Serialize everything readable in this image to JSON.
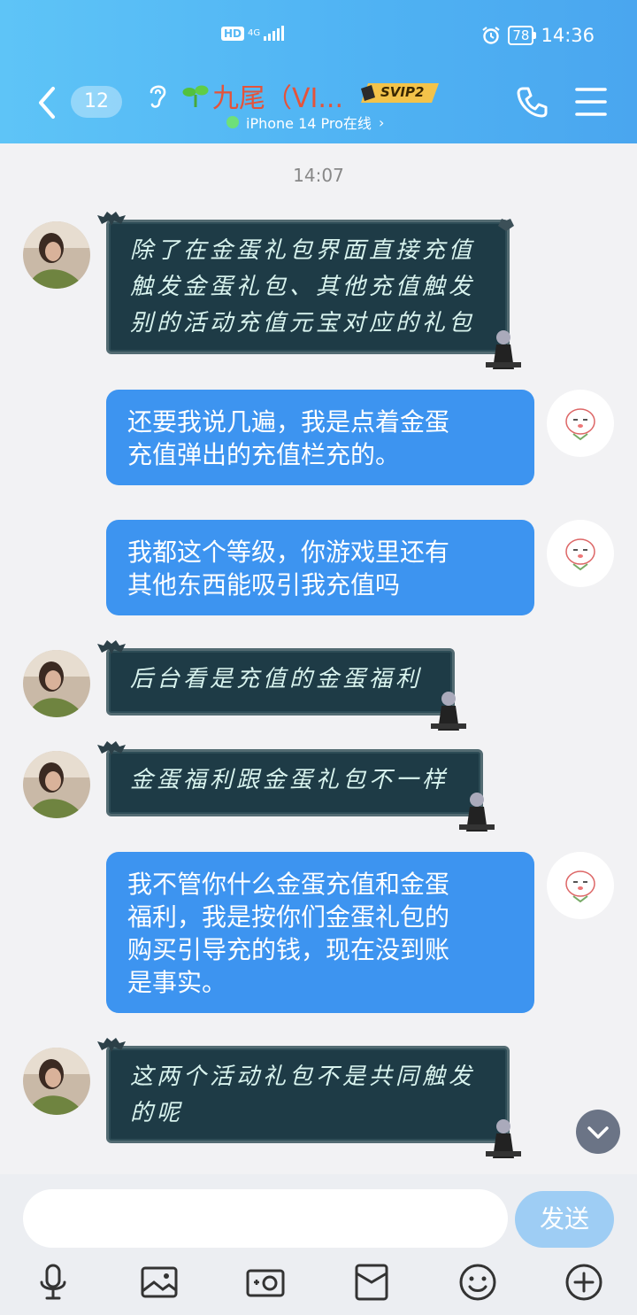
{
  "status_bar": {
    "hd": "HD",
    "network": "4G",
    "battery": "78",
    "time": "14:36"
  },
  "header": {
    "unread_count": "12",
    "contact_name": "九尾（VI...",
    "svip_badge": "SVIP2",
    "online_status": "iPhone 14 Pro在线",
    "online_chevron": "›"
  },
  "chat": {
    "timestamp": "14:07",
    "messages": [
      {
        "side": "in",
        "lines": [
          "除了在金蛋礼包界面直接充值",
          "触发金蛋礼包、其他充值触发",
          "别的活动充值元宝对应的礼包"
        ]
      },
      {
        "side": "out",
        "lines": [
          "还要我说几遍，我是点着金蛋",
          "充值弹出的充值栏充的。"
        ]
      },
      {
        "side": "out",
        "lines": [
          "我都这个等级，你游戏里还有",
          "其他东西能吸引我充值吗"
        ]
      },
      {
        "side": "in",
        "lines": [
          "后台看是充值的金蛋福利"
        ]
      },
      {
        "side": "in",
        "lines": [
          "金蛋福利跟金蛋礼包不一样"
        ]
      },
      {
        "side": "out",
        "lines": [
          "我不管你什么金蛋充值和金蛋",
          "福利，我是按你们金蛋礼包的",
          "购买引导充的钱，现在没到账",
          "是事实。"
        ]
      },
      {
        "side": "in",
        "lines": [
          "这两个活动礼包不是共同触发",
          "的呢"
        ]
      }
    ]
  },
  "input_bar": {
    "placeholder": "",
    "send_label": "发送"
  },
  "toolbar": [
    "microphone-icon",
    "image-icon",
    "camera-icon",
    "red-packet-icon",
    "emoji-icon",
    "plus-icon"
  ],
  "colors": {
    "header_gradient_start": "#5ec4f7",
    "header_gradient_end": "#4aa6ef",
    "outgoing_bubble": "#3d94f0",
    "incoming_bubble": "#1e3b46",
    "contact_name": "#e5533a",
    "send_button": "#9ecdf4"
  }
}
